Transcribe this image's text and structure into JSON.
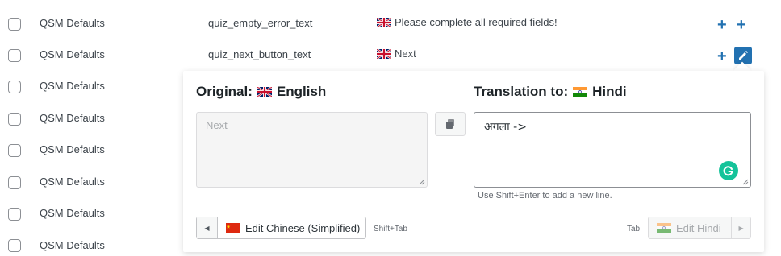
{
  "rows": [
    {
      "domain": "QSM Defaults",
      "name": "quiz_empty_error_text",
      "value": "Please complete all required fields!"
    },
    {
      "domain": "QSM Defaults",
      "name": "quiz_next_button_text",
      "value": "Next"
    },
    {
      "domain": "QSM Defaults"
    },
    {
      "domain": "QSM Defaults"
    },
    {
      "domain": "QSM Defaults"
    },
    {
      "domain": "QSM Defaults"
    },
    {
      "domain": "QSM Defaults"
    },
    {
      "domain": "QSM Defaults"
    }
  ],
  "editor": {
    "original_prefix": "Original:",
    "original_lang": "English",
    "translation_prefix": "Translation to:",
    "translation_lang": "Hindi",
    "original_text": "Next",
    "translation_text": "अगला ->",
    "hint": "Use Shift+Enter to add a new line.",
    "prev_label": "Edit Chinese (Simplified)",
    "prev_shortcut": "Shift+Tab",
    "next_shortcut": "Tab",
    "next_label": "Edit Hindi"
  },
  "colors": {
    "accent": "#2271b1",
    "grammarly": "#15c39a"
  },
  "icons": {
    "add": "plus-icon",
    "edit": "pencil-icon",
    "copy": "copy-icon",
    "grammarly": "grammarly-icon"
  }
}
